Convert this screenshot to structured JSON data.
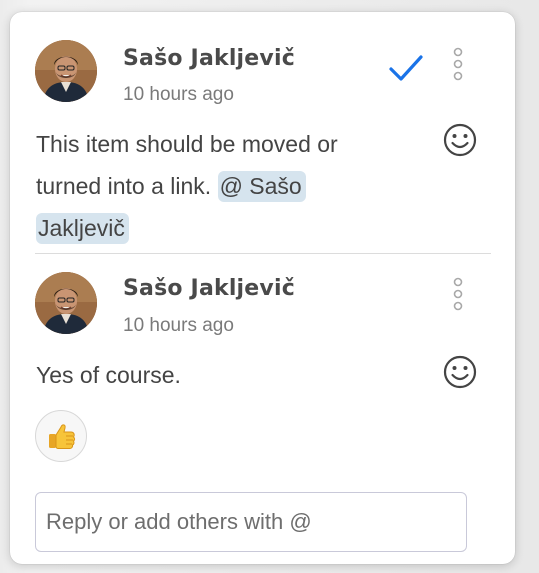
{
  "comments": [
    {
      "author": "Sašo Jakljevič",
      "time": "10 hours ago",
      "text_line1": "This item should be moved or",
      "text_line2_prefix": "turned into a link.",
      "mention_part1": "@ Sašo",
      "mention_part2": "Jakljevič",
      "icons": [
        "check-icon",
        "more-vertical-icon",
        "smiley-icon"
      ]
    },
    {
      "author": "Sašo Jakljevič",
      "time": "10 hours ago",
      "text": "Yes of course.",
      "reaction": "thumbs-up",
      "icons": [
        "more-vertical-icon",
        "smiley-icon"
      ]
    }
  ],
  "reply": {
    "placeholder": "Reply or add others with @"
  },
  "colors": {
    "check": "#1a73e8",
    "mention_bg": "#d6e4ee",
    "author": "#4a4a4a",
    "muted": "#7a7a7a"
  }
}
